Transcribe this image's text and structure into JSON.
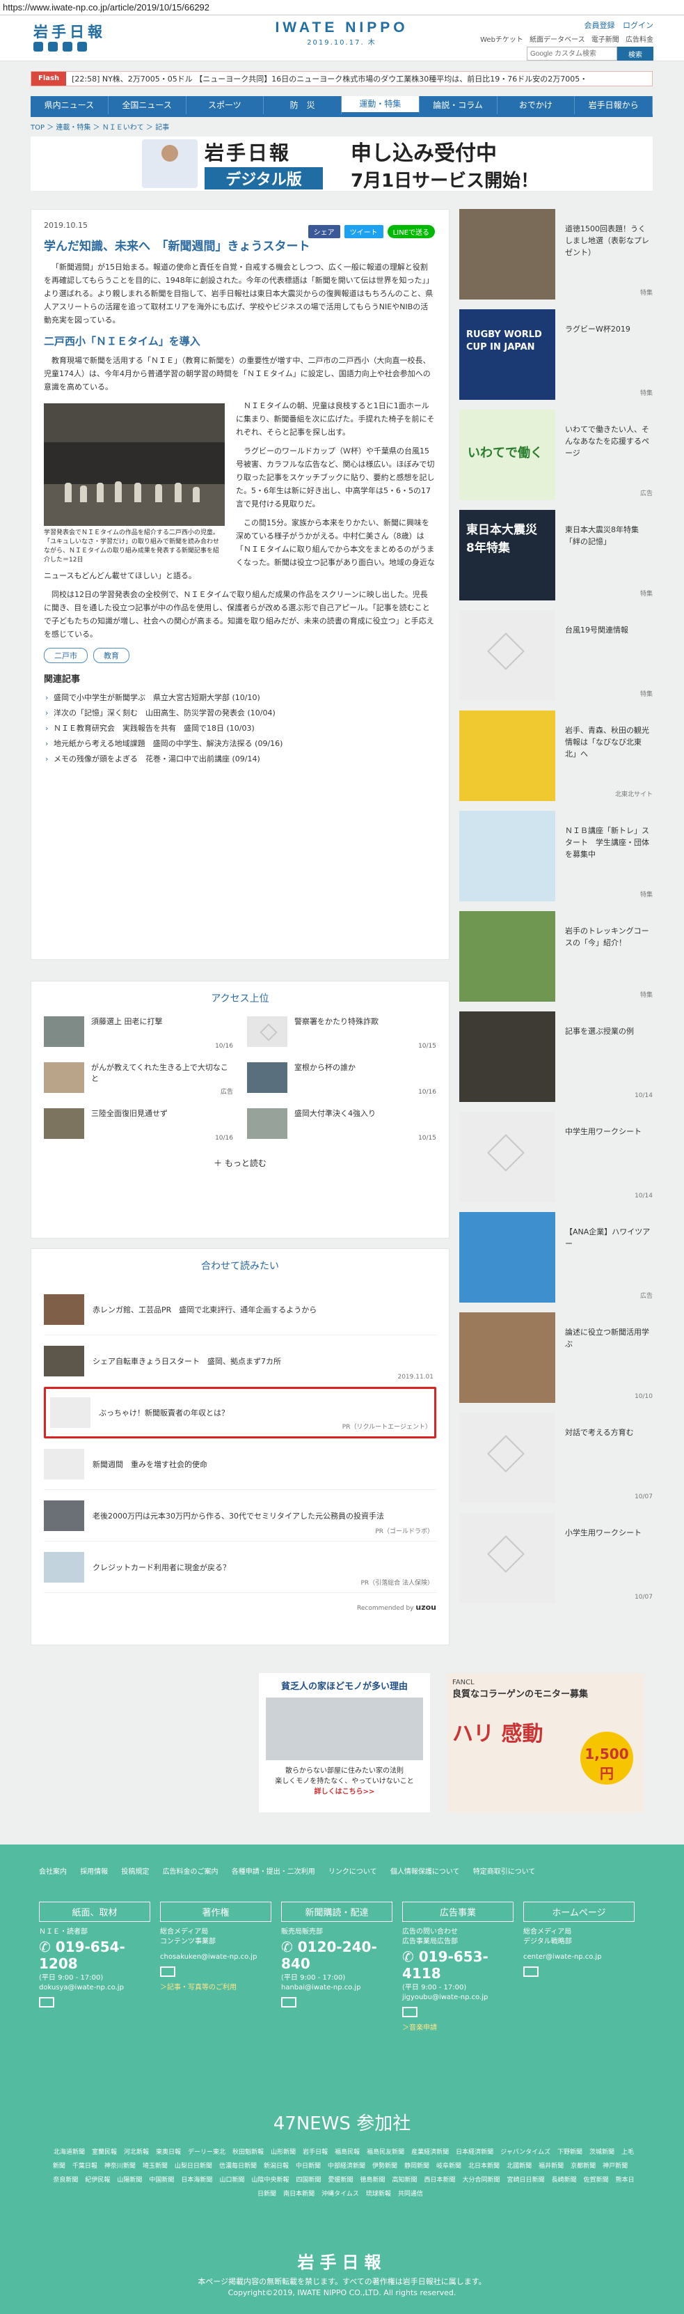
{
  "browser": {
    "url": "https://www.iwate-np.co.jp/article/2019/10/15/66292"
  },
  "header": {
    "logo_text": "岩手日報",
    "center_title": "IWATE NIPPO",
    "center_date": "2019.10.17. 木",
    "login": {
      "register": "会員登録",
      "login": "ログイン"
    },
    "sub_links": [
      "Webチケット",
      "紙面データベース",
      "電子新聞",
      "広告料金"
    ],
    "search_placeholder": "Google カスタム検索",
    "search_button": "検索"
  },
  "flash": {
    "label": "Flash",
    "text": "[22:58] NY株、2万7005・05ドル 【ニューヨーク共同】16日のニューヨーク株式市場のダウ工業株30種平均は、前日比19・76ドル安の2万7005・"
  },
  "nav": {
    "items": [
      "県内ニュース",
      "全国ニュース",
      "スポーツ",
      "防　災",
      "運動・特集",
      "論説・コラム",
      "おでかけ",
      "岩手日報から"
    ],
    "active_index": 4
  },
  "breadcrumb": "TOP ＞ 連載・特集 ＞ ＮＩＥいわて ＞ 記事",
  "ad_banner": {
    "logo": "岩手日報",
    "badge": "デジタル版",
    "line1": "申し込み受付中",
    "line2": "7月1日サービス開始！"
  },
  "article": {
    "date": "2019.10.15",
    "share": {
      "facebook": "シェア",
      "twitter": "ツイート",
      "line": "LINEで送る"
    },
    "title": "学んだ知識、未来へ　「新聞週間」きょうスタート",
    "p1": "「新聞週間」が15日始まる。報道の使命と責任を自覚・自戒する機会としつつ、広く一般に報道の理解と役割を再確認してもらうことを目的に、1948年に創設された。今年の代表標語は「新聞を開いて伝は世界を知った」」より選ばれる。より親しまれる新聞を目指して、岩手日報社は東日本大震災からの復興報道はもちろんのこと、県人アスリートらの活躍を追って取材エリアを海外にも広げ、学校やビジネスの場で活用してもらうNIEやNIBの活動充実を図っている。",
    "subhead": "二戸西小「ＮＩＥタイム」を導入",
    "p2": "教育現場で新聞を活用する「ＮＩＥ」（教育に新聞を）の重要性が増す中、二戸市の二戸西小（大向直一校長、児童174人）は、今年4月から普通学習の朝学習の時間を「ＮＩＥタイム」に設定し、国語力向上や社会参加への意識を高めている。",
    "p3": "ＮＩＥタイムの朝、児童は良枝すると1日に1面ホールに集まり、新聞番組を次に広げた。手提れた椅子を前にそれぞれ、そらと記事を探し出す。",
    "p4": "ラグビーのワールドカップ（Ｗ杯）や千葉県の台風15号被害、カラフルな広告など、関心は様広い。ほぼみで切り取った記事をスケッチブックに貼り、要約と感想を記した。5・6年生は新に好き出し、中高学年は5・6・5の17言で見付ける見取りだ。",
    "p5": "この間15分。家族から本来をりかたい、新聞に興味を深めている様子がうかがえる。中村仁美さん（8歳）は「ＮＩＥタイムに取り組んでから本文をまとめるのがうまくなった。新聞は役立つ記事があり面白い。地域の身近なニュースもどんどん載せてほしい」と語る。",
    "p6": "同校は12日の学習発表会の全校例で、ＮＩＥタイムで取り組んだ成果の作品をスクリーンに映し出した。児長に聞き、目を通した役立つ記事が中の作品を使用し、保護者らが改める選ぶ形で自己アピール。「記事を読むことで子どもたちの知識が増し、社会への関心が高まる。知識を取り組みだが、未来の読書の育成に役立つ」と手応えを感じている。",
    "figure_caption": "学習発表会でＮＩＥタイムの作品を紹介する二戸西小の児童。「ユキュしいなさ・学習だけ」の取り組みで新聞を読み合わせながら、ＮＩＥタイムの取り組み成果を発表する新聞記事を紹介した＝12日",
    "tags": [
      "二戸市",
      "教育"
    ],
    "related_title": "関連記事",
    "related": [
      "盛岡で小中学生が新聞学ぶ　県立大宮古短期大学部 (10/10)",
      "洋次の「記憶」深く刻む　山田高生、防災学習の発表会 (10/04)",
      "ＮＩＥ教育研究会　実践報告を共有　盛岡で18日 (10/03)",
      "地元紙から考える地域課題　盛岡の中学生、解決方法探る (09/16)",
      "メモの残像が頭をよぎる　花巻・湯口中で出前講座 (09/14)"
    ]
  },
  "ranking": {
    "title": "アクセス上位",
    "items": [
      {
        "text": "須藤選上 田老に打撃",
        "date": "10/16"
      },
      {
        "text": "警察署をかたり特殊詐欺",
        "date": "10/15"
      },
      {
        "text": "がんが教えてくれた生きる上で大切なこと",
        "date": "広告"
      },
      {
        "text": "室根から杯の誰か",
        "date": "10/16"
      },
      {
        "text": "三陸全面復旧見通せず",
        "date": "10/16"
      },
      {
        "text": "盛岡大付準決く4強入り",
        "date": "10/15"
      }
    ],
    "more": "もっと読む"
  },
  "recommendations": {
    "title": "合わせて読みたい",
    "items": [
      {
        "text": "赤レンガ館、工芸品PR　盛岡で北東評行、通年企画するようから",
        "meta": ""
      },
      {
        "text": "シェア自転車きょう日スタート　盛岡、拠点まず7カ所",
        "meta": "2019.11.01"
      },
      {
        "text": "ぶっちゃけ！新聞販賣者の年収とは？",
        "meta": "PR（リクルートエージェント）"
      },
      {
        "text": "新聞週間　重みを増す社会的使命",
        "meta": ""
      },
      {
        "text": "老後2000万円は元本30万円から作る、30代でセミリタイアした元公務員の投資手法",
        "meta": "PR（ゴールドラボ）"
      },
      {
        "text": "クレジットカード利用者に現金が戻る？",
        "meta": "PR（引落総合 法人保険）"
      }
    ],
    "powered_by": "Recommended by",
    "powered_brand": "uzou"
  },
  "sidebar": [
    {
      "text": "道徳1500回表題！うくしまし地選（表彰なプレゼント）",
      "tag": "特集",
      "thumb": "#7a6a58"
    },
    {
      "text": "ラグビーW杯2019",
      "tag": "特集",
      "thumb": "#1b3a73",
      "label": "RUGBY WORLD CUP IN JAPAN"
    },
    {
      "text": "いわてで働きたい人、そんなあなたを応援するページ",
      "tag": "広告",
      "thumb": "#e6f2d8",
      "label": "いわてで働く"
    },
    {
      "text": "東日本大震災8年特集「絆の記憶」",
      "tag": "特集",
      "thumb": "#1e2a3a",
      "label": "東日本大震災 8年特集"
    },
    {
      "text": "台風19号関連情報",
      "tag": "特集",
      "thumb": ""
    },
    {
      "text": "岩手、青森、秋田の観光情報は「なびなび北東北」へ",
      "tag": "北東北サイト",
      "thumb": "#f0c830"
    },
    {
      "text": "ＮＩＢ講座「新トレ」スタート　学生講座・団体を募集中",
      "tag": "特集",
      "thumb": "#cfe4ef"
    },
    {
      "text": "岩手のトレッキングコースの「今」紹介！",
      "tag": "特集",
      "thumb": "#6f9752"
    },
    {
      "text": "記事を選ぶ授業の例",
      "tag": "10/14",
      "thumb": "#3e3a34"
    },
    {
      "text": "中学生用ワークシート",
      "tag": "10/14",
      "thumb": ""
    },
    {
      "text": "【ANA企業】ハワイツアー",
      "tag": "広告",
      "thumb": "#3e8fce"
    },
    {
      "text": "論述に役立つ新聞活用学ぶ",
      "tag": "10/10",
      "thumb": "#9b7a5c"
    },
    {
      "text": "対話で考える方育む",
      "tag": "10/07",
      "thumb": ""
    },
    {
      "text": "小学生用ワークシート",
      "tag": "10/07",
      "thumb": ""
    }
  ],
  "ads_bottom": {
    "ad1_title": "貧乏人の家ほどモノが多い理由",
    "ad1_sub1": "散らからない部屋に住みたい家の法則",
    "ad1_sub2": "楽しくモノを持たなく、やっていけないこと",
    "ad1_more": "詳しくはこちら>>",
    "ad2_brand": "FANCL",
    "ad2_title": "良質なコラーゲンのモニター募集",
    "ad2_big": "ハリ 感動",
    "ad2_price": "1,500円"
  },
  "footer": {
    "links": [
      "会社案内",
      "採用情報",
      "投稿規定",
      "広告料金のご案内",
      "各種申請・提出・二次利用",
      "リンクについて",
      "個人情報保護について",
      "特定商取引について"
    ],
    "contacts": [
      {
        "heading": "紙面、取材",
        "lines": [
          "ＮＩＥ・読者部"
        ],
        "tel": "019-654-1208",
        "hours": "(平日 9:00 - 17:00)",
        "email": "dokusya@iwate-np.co.jp",
        "link": ""
      },
      {
        "heading": "著作権",
        "lines": [
          "総合メディア局",
          "コンテンツ事業部"
        ],
        "tel": "",
        "hours": "",
        "email": "chosakuken@iwate-np.co.jp",
        "link": "＞記事・写真等のご利用"
      },
      {
        "heading": "新聞購読・配達",
        "lines": [
          "販売局販売部"
        ],
        "tel": "0120-240-840",
        "hours": "(平日 9:00 - 17:00)",
        "email": "hanbai@iwate-np.co.jp",
        "link": ""
      },
      {
        "heading": "広告事業",
        "lines": [
          "広告の問い合わせ",
          "広告事業局広告部"
        ],
        "tel": "019-653-4118",
        "hours": "(平日 9:00 - 17:00)",
        "email": "jigyoubu@iwate-np.co.jp",
        "link": "＞音楽申請"
      },
      {
        "heading": "ホームページ",
        "lines": [
          "総合メディア局",
          "デジタル戦略部"
        ],
        "tel": "",
        "hours": "",
        "email": "center@iwate-np.co.jp",
        "link": ""
      }
    ],
    "news47_title": "47NEWS 参加社",
    "news47": [
      "北海道新聞",
      "室蘭民報",
      "河北新報",
      "東奥日報",
      "デーリー東北",
      "秋田魁新報",
      "山形新聞",
      "岩手日報",
      "福島民報",
      "福島民友新聞",
      "産業経済新聞",
      "日本経済新聞",
      "ジャパンタイムズ",
      "下野新聞",
      "茨城新聞",
      "上毛新聞",
      "千葉日報",
      "神奈川新聞",
      "埼玉新聞",
      "山梨日日新聞",
      "信濃毎日新聞",
      "新潟日報",
      "中日新聞",
      "中部経済新聞",
      "伊勢新聞",
      "静岡新聞",
      "岐阜新聞",
      "北日本新聞",
      "北國新聞",
      "福井新聞",
      "京都新聞",
      "神戸新聞",
      "奈良新聞",
      "紀伊民報",
      "山陽新聞",
      "中国新聞",
      "日本海新聞",
      "山口新聞",
      "山陰中央新報",
      "四国新聞",
      "愛媛新聞",
      "徳島新聞",
      "高知新聞",
      "西日本新聞",
      "大分合同新聞",
      "宮崎日日新聞",
      "長崎新聞",
      "佐賀新聞",
      "熊本日日新聞",
      "南日本新聞",
      "沖縄タイムス",
      "琉球新報",
      "共同通信"
    ],
    "logo": "岩手日報",
    "copy1": "本ページ掲載内容の無断転載を禁じます。すべての著作権は岩手日報社に属します。",
    "copy2": "Copyright©2019, IWATE NIPPO CO.,LTD. All rights reserved."
  }
}
